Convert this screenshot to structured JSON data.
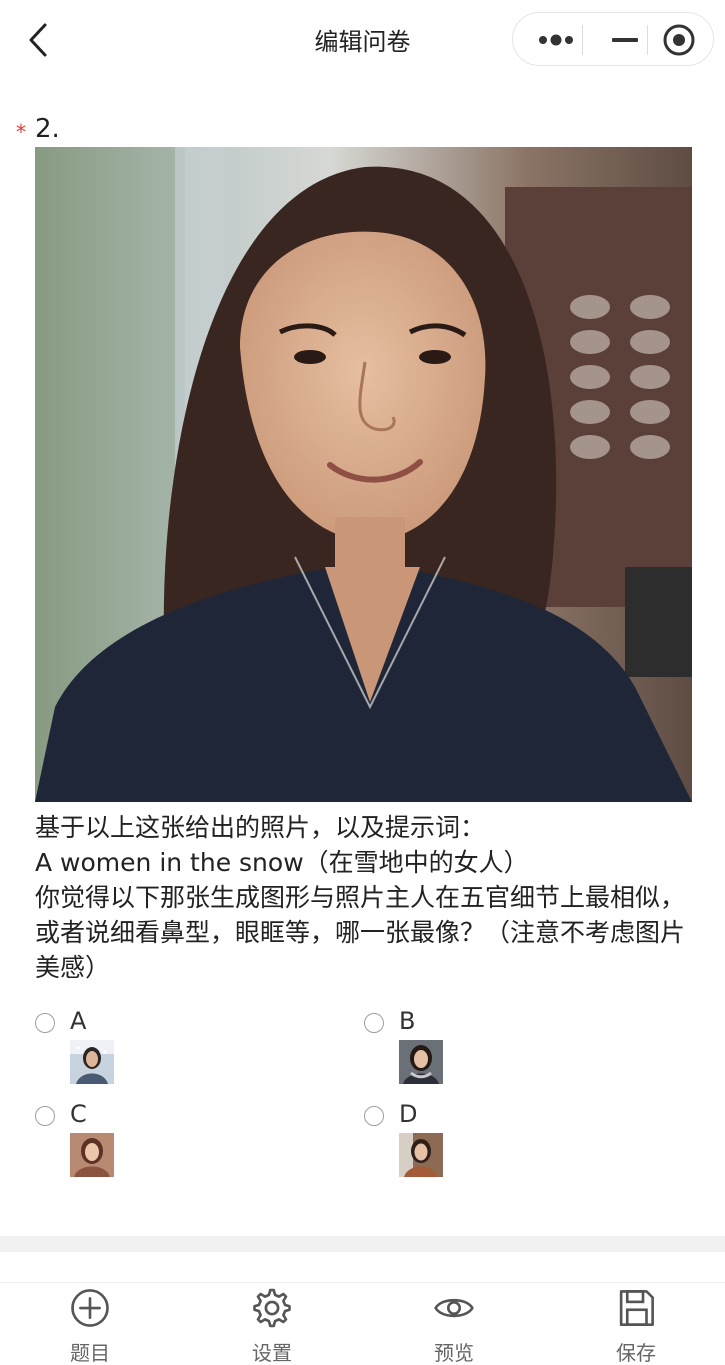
{
  "header": {
    "title": "编辑问卷"
  },
  "question": {
    "required_mark": "*",
    "number": "2.",
    "text_lines": [
      "基于以上这张给出的照片，以及提示词：",
      "A women in the snow（在雪地中的女人）",
      "你觉得以下那张生成图形与照片主人在五官细节上最相似，或者说细看鼻型，眼眶等，哪一张最像？（注意不考虑图片美感）"
    ],
    "options": [
      {
        "label": "A"
      },
      {
        "label": "B"
      },
      {
        "label": "C"
      },
      {
        "label": "D"
      }
    ]
  },
  "tabbar": {
    "items": [
      {
        "label": "题目",
        "icon": "plus-circle-icon"
      },
      {
        "label": "设置",
        "icon": "gear-icon"
      },
      {
        "label": "预览",
        "icon": "eye-icon"
      },
      {
        "label": "保存",
        "icon": "save-icon"
      }
    ]
  },
  "colors": {
    "required": "#e53935",
    "text": "#222222",
    "tab_icon": "#555555"
  }
}
